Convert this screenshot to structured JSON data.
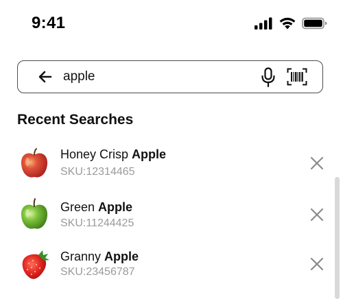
{
  "status_bar": {
    "time": "9:41",
    "icons": [
      "signal-icon",
      "wifi-icon",
      "battery-icon"
    ]
  },
  "search": {
    "value": "apple",
    "icons": [
      "back-arrow-icon",
      "microphone-icon",
      "barcode-scan-icon"
    ]
  },
  "recent": {
    "title": "Recent Searches",
    "items": [
      {
        "prefix": "Honey Crisp ",
        "highlight": "Apple",
        "sku": "SKU:12314465",
        "thumb": "red-apple-image"
      },
      {
        "prefix": "Green ",
        "highlight": "Apple",
        "sku": "SKU:11244425",
        "thumb": "green-apple-image"
      },
      {
        "prefix": "Granny ",
        "highlight": "Apple",
        "sku": "SKU:23456787",
        "thumb": "strawberry-image"
      }
    ]
  },
  "colors": {
    "border": "#4a4a4a",
    "sku_text": "#9a9a9a",
    "remove_icon": "#8a8a8a",
    "scrollbar": "#d9d9d9"
  }
}
